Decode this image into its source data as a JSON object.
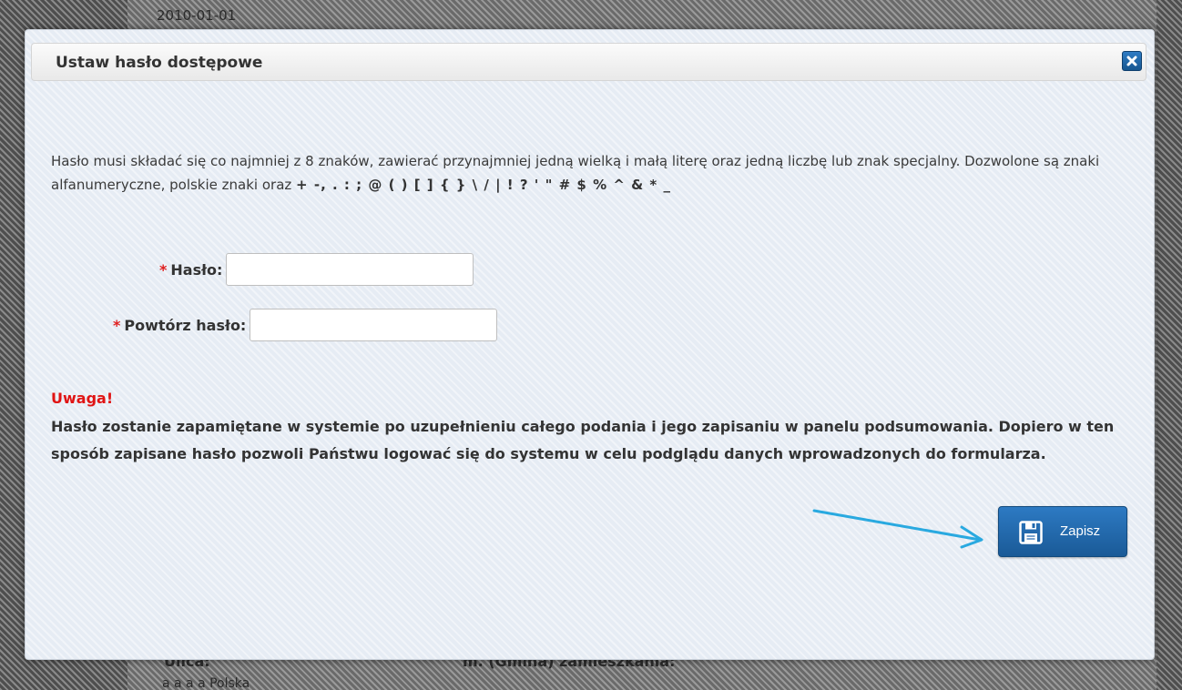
{
  "background": {
    "date_text": "2010-01-01",
    "street_label": "Ulica:",
    "city_label": "m. (Gmina) zamieszkania:",
    "more_text": "a a a a Polska"
  },
  "dialog": {
    "title": "Ustaw hasło dostępowe",
    "info_text": "Hasło musi składać się co najmniej z 8 znaków, zawierać przynajmniej jedną wielką i małą literę oraz jedną liczbę lub znak specjalny. Dozwolone są znaki alfanumeryczne, polskie znaki oraz",
    "special_chars": "+ -, . : ; @ ( ) [ ] { } \\ / | ! ? ' \" # $ % ^ & * _",
    "fields": {
      "required_marker": "*",
      "password_label": "Hasło:",
      "password_value": "",
      "repeat_label": "Powtórz hasło:",
      "repeat_value": ""
    },
    "warning": {
      "title": "Uwaga!",
      "text": "Hasło zostanie zapamiętane w systemie po uzupełnieniu całego podania i jego zapisaniu w panelu podsumowania. Dopiero w ten sposób zapisane hasło pozwoli Państwu logować się do systemu w celu podglądu danych wprowadzonych do formularza."
    },
    "save_label": "Zapisz"
  },
  "colors": {
    "accent_button": "#1f67ad",
    "warning_red": "#e01414",
    "annotation_arrow": "#29a9e0"
  },
  "icons": {
    "close": "close-icon",
    "save": "floppy-disk-icon",
    "annotation": "arrow-annotation-icon"
  }
}
